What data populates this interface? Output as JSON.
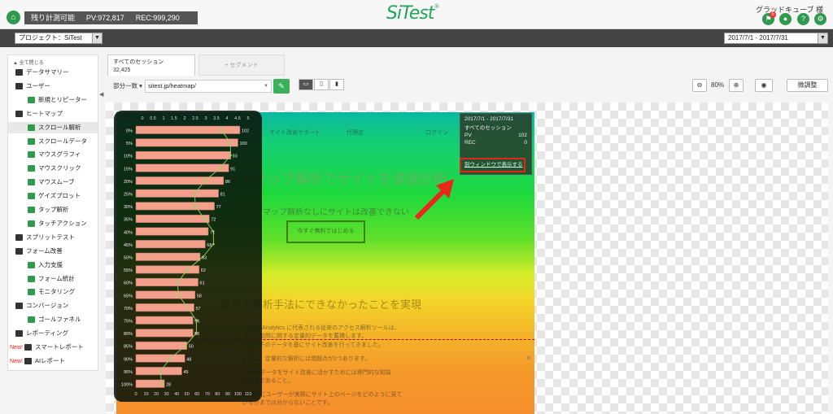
{
  "header": {
    "quota_label": "残り計測可能",
    "pv_label": "PV:972,817",
    "rec_label": "REC:999,290",
    "logo": "SiTest",
    "user": "グラッドキューブ 様",
    "notification_count": "5"
  },
  "projectbar": {
    "project": "プロジェクト：SiTest",
    "date_range": "2017/7/1 - 2017/7/31"
  },
  "sidebar": {
    "collapse_all": "全て閉じる",
    "items": [
      {
        "label": "データサマリー",
        "level": 0,
        "icon": "summary-icon"
      },
      {
        "label": "ユーザー",
        "level": 0,
        "icon": "user-icon"
      },
      {
        "label": "新規とリピーター",
        "level": 1,
        "icon": "new-repeater-icon"
      },
      {
        "label": "ヒートマップ",
        "level": 0,
        "icon": "heatmap-icon"
      },
      {
        "label": "スクロール解析",
        "level": 1,
        "icon": "scroll-icon",
        "selected": true
      },
      {
        "label": "スクロールデータ",
        "level": 1,
        "icon": "scroll-data-icon"
      },
      {
        "label": "マウスグラフィ",
        "level": 1,
        "icon": "mouse-graphy-icon"
      },
      {
        "label": "マウスクリック",
        "level": 1,
        "icon": "mouse-click-icon"
      },
      {
        "label": "マウスムーブ",
        "level": 1,
        "icon": "mouse-move-icon"
      },
      {
        "label": "ゲイズプロット",
        "level": 1,
        "icon": "gaze-plot-icon"
      },
      {
        "label": "タップ解析",
        "level": 1,
        "icon": "tap-icon"
      },
      {
        "label": "タッチアクション",
        "level": 1,
        "icon": "touch-icon"
      },
      {
        "label": "スプリットテスト",
        "level": 0,
        "icon": "split-test-icon"
      },
      {
        "label": "フォーム改善",
        "level": 0,
        "icon": "form-icon"
      },
      {
        "label": "入力支援",
        "level": 1,
        "icon": "input-assist-icon"
      },
      {
        "label": "フォーム統計",
        "level": 1,
        "icon": "form-stats-icon"
      },
      {
        "label": "モニタリング",
        "level": 1,
        "icon": "monitoring-icon"
      },
      {
        "label": "コンバージョン",
        "level": 0,
        "icon": "conversion-icon"
      },
      {
        "label": "ゴールファネル",
        "level": 1,
        "icon": "funnel-icon"
      },
      {
        "label": "レポーティング",
        "level": 0,
        "icon": "report-icon"
      },
      {
        "label": "スマートレポート",
        "level": 0,
        "icon": "smart-report-icon",
        "new": "New!"
      },
      {
        "label": "AIレポート",
        "level": 0,
        "icon": "ai-report-icon",
        "new": "New!"
      }
    ]
  },
  "tabs": {
    "all_sessions": "すべてのセッション",
    "all_sessions_count": "32,425",
    "segment": "+ セグメント"
  },
  "toolbar": {
    "match": "部分一致 ▾",
    "url": "sitest.jp/heatmap/",
    "zoom": "80%",
    "adjust": "微調整"
  },
  "page": {
    "nav_support": "サイト改善サポート",
    "nav_agency": "代理店",
    "nav_login": "ログイン",
    "hero_title": "ヒートマップ解析でサイトを健康診断",
    "hero_sub": "ヒートマップ解析なしにサイトは改善できない",
    "cta": "今すぐ無料ではじめる",
    "section_title": "従来の解析手法にできなかったことを実現",
    "lines": [
      "Google Analytics に代表される従来のアクセス解析ツールは、",
      "サイト訪問に関する定量的データを蓄積します。",
      "そしてそのデータを基にサイト改善を行ってきました。",
      "しかし、定量的な解析には問題点が2つあります。",
      "1. 解析データをサイト改善に活かすためには専門的な知識",
      "が必要であること。",
      "2. 実際にユーザーが実際にサイト上のページをどのように見て",
      "いるかまでは分からないことです。"
    ],
    "fold_label": "6/"
  },
  "info_box": {
    "date": "2017/7/1 - 2017/7/31",
    "segment": "すべてのセッション",
    "pv_label": "PV",
    "pv_value": "102",
    "rec_label": "REC",
    "rec_value": "0",
    "link": "別ウィンドウで表示する"
  },
  "chart_data": {
    "type": "bar",
    "orientation": "horizontal",
    "categories": [
      "0%",
      "5%",
      "10%",
      "15%",
      "20%",
      "25%",
      "30%",
      "35%",
      "40%",
      "45%",
      "50%",
      "55%",
      "60%",
      "65%",
      "70%",
      "75%",
      "80%",
      "85%",
      "90%",
      "95%",
      "100%"
    ],
    "values": [
      102,
      100,
      93,
      91,
      86,
      81,
      77,
      72,
      71,
      68,
      63,
      62,
      61,
      58,
      57,
      56,
      56,
      50,
      48,
      45,
      28
    ],
    "xlim": [
      0,
      110
    ],
    "xticks": [
      0,
      10,
      20,
      30,
      40,
      50,
      60,
      70,
      80,
      90,
      100,
      110
    ],
    "top_axis_ticks": [
      "0",
      "0.5",
      "1",
      "1.5",
      "2",
      "2.5",
      "3",
      "3.5",
      "4",
      "4.5",
      "5"
    ],
    "bar_color": "#f2a08c",
    "line_color": "#9ad06a"
  }
}
